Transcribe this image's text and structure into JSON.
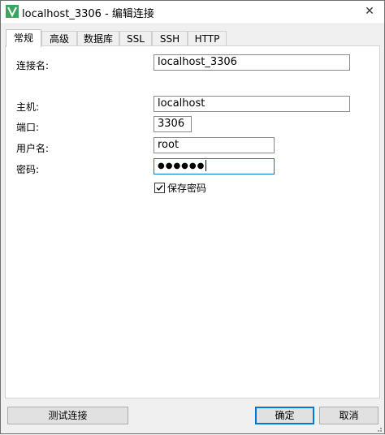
{
  "window": {
    "title": "localhost_3306 - 编辑连接",
    "close_glyph": "✕"
  },
  "tabs": [
    {
      "label": "常规",
      "active": true
    },
    {
      "label": "高级",
      "active": false
    },
    {
      "label": "数据库",
      "active": false
    },
    {
      "label": "SSL",
      "active": false
    },
    {
      "label": "SSH",
      "active": false
    },
    {
      "label": "HTTP",
      "active": false
    }
  ],
  "form": {
    "connection_name_label": "连接名:",
    "connection_name_value": "localhost_3306",
    "host_label": "主机:",
    "host_value": "localhost",
    "port_label": "端口:",
    "port_value": "3306",
    "username_label": "用户名:",
    "username_value": "root",
    "password_label": "密码:",
    "password_value": "●●●●●●",
    "save_password_label": "保存密码",
    "save_password_checked": true
  },
  "buttons": {
    "test_connection": "测试连接",
    "ok": "确定",
    "cancel": "取消"
  },
  "colors": {
    "accent": "#0078d7",
    "app_icon": "#3aa55c"
  },
  "icons": {
    "app": "navicat-app-icon",
    "close": "close-icon",
    "check": "checkmark-icon"
  }
}
